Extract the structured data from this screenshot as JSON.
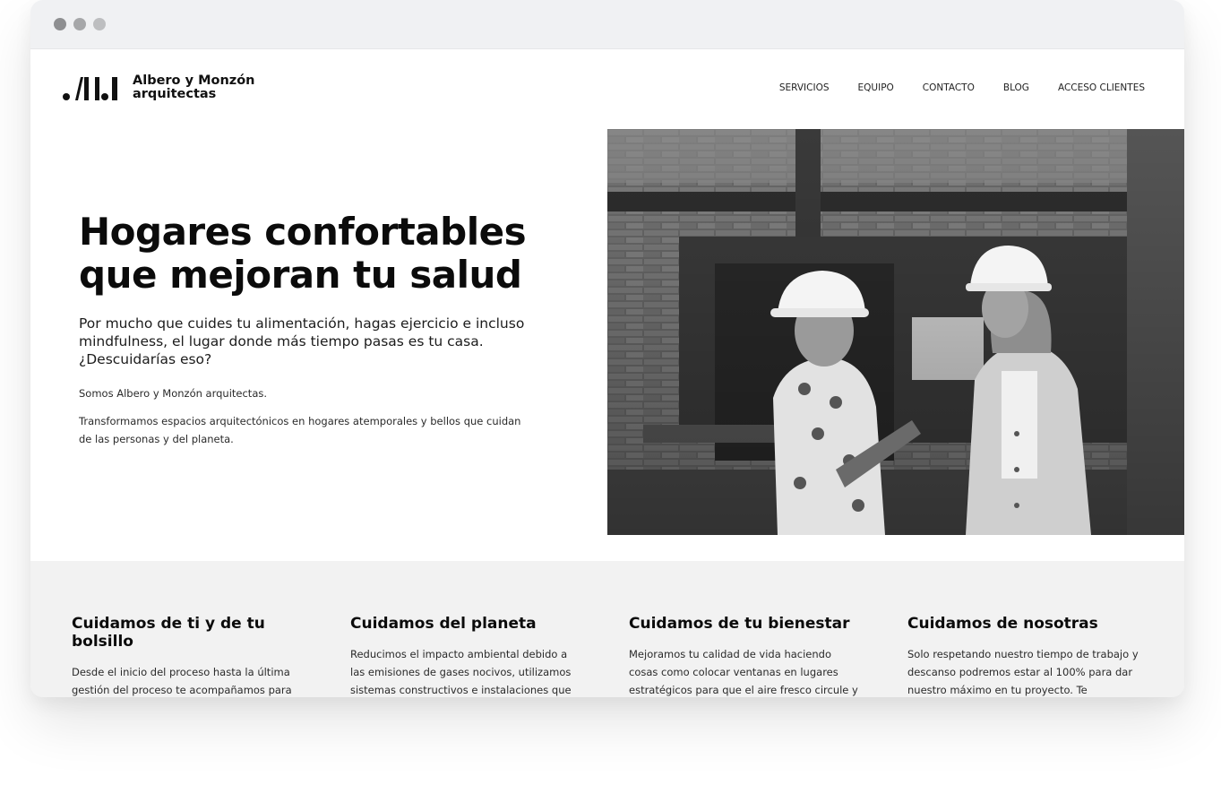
{
  "browser": {
    "window_buttons": [
      "close",
      "minimize",
      "maximize"
    ]
  },
  "brand": {
    "name_line1": "Albero y Monzón",
    "name_line2": "arquitectas",
    "logo_icon": "aym-logo-mark"
  },
  "nav": {
    "items": [
      {
        "label": "SERVICIOS"
      },
      {
        "label": "EQUIPO"
      },
      {
        "label": "CONTACTO"
      },
      {
        "label": "BLOG"
      },
      {
        "label": "ACCESO CLIENTES"
      }
    ]
  },
  "hero": {
    "title": "Hogares confortables\nque mejoran tu salud",
    "lead": "Por mucho que cuides tu alimentación, hagas ejercicio e incluso\nmindfulness, el lugar donde más tiempo pasas es tu casa.\n¿Descuidarías eso?",
    "paragraph1": "Somos Albero y Monzón arquitectas.",
    "paragraph2": "Transformamos espacios arquitectónicos en hogares atemporales y bellos que cuidan de las personas y del planeta.",
    "photo": "two-architects-in-hard-hats-photo"
  },
  "features": [
    {
      "title": "Cuidamos de ti y de tu bolsillo",
      "text": "Desde el inicio del proceso hasta la última gestión del proceso te acompañamos para"
    },
    {
      "title": "Cuidamos del planeta",
      "text": "Reducimos el impacto ambiental debido a las emisiones de gases nocivos, utilizamos sistemas constructivos e instalaciones que"
    },
    {
      "title": "Cuidamos de tu bienestar",
      "text": "Mejoramos tu calidad de vida haciendo cosas como colocar ventanas en lugares estratégicos para que el aire fresco circule y"
    },
    {
      "title": "Cuidamos de nosotras",
      "text": "Solo respetando nuestro tiempo de trabajo y descanso podremos estar al 100% para dar nuestro máximo en tu proyecto. Te"
    }
  ],
  "colors": {
    "text": "#0b0b0b",
    "features_bg": "#f2f2f2",
    "chrome_bg": "#f0f1f3"
  }
}
